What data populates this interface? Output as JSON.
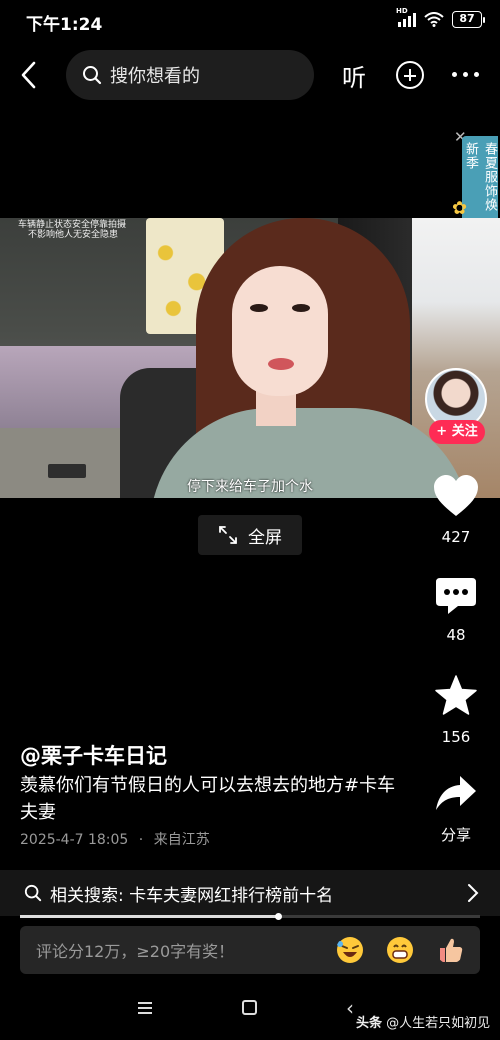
{
  "status_bar": {
    "time": "下午1:24",
    "network": "HD",
    "battery": "87"
  },
  "top_nav": {
    "search_placeholder": "搜你想看的",
    "listen_label": "听"
  },
  "ad": {
    "text": "春夏服饰焕新季"
  },
  "video": {
    "top_caption_line1": "车辆静止状态安全停靠拍摄",
    "top_caption_line2": "不影响他人无安全隐患",
    "subtitle": "停下来给车子加个水",
    "fullscreen_label": "全屏"
  },
  "creator": {
    "follow_label": "+ 关注"
  },
  "rail": {
    "likes": "427",
    "comments": "48",
    "favorites": "156",
    "share_label": "分享"
  },
  "post": {
    "author": "@栗子卡车日记",
    "caption": "羡慕你们有节假日的人可以去想去的地方#卡车夫妻",
    "date": "2025-4-7 18:05",
    "separator": "·",
    "location": "来自江苏"
  },
  "related_search": {
    "text": "相关搜索: 卡车夫妻网红排行榜前十名"
  },
  "playback": {
    "progress": 0.56
  },
  "comment_bar": {
    "placeholder": "评论分12万，≥20字有奖！"
  },
  "watermark": {
    "source": "头条",
    "handle": "@人生若只如初见"
  },
  "colors": {
    "follow": "#fe2c55",
    "ad_banner": "#4a9fb6"
  }
}
